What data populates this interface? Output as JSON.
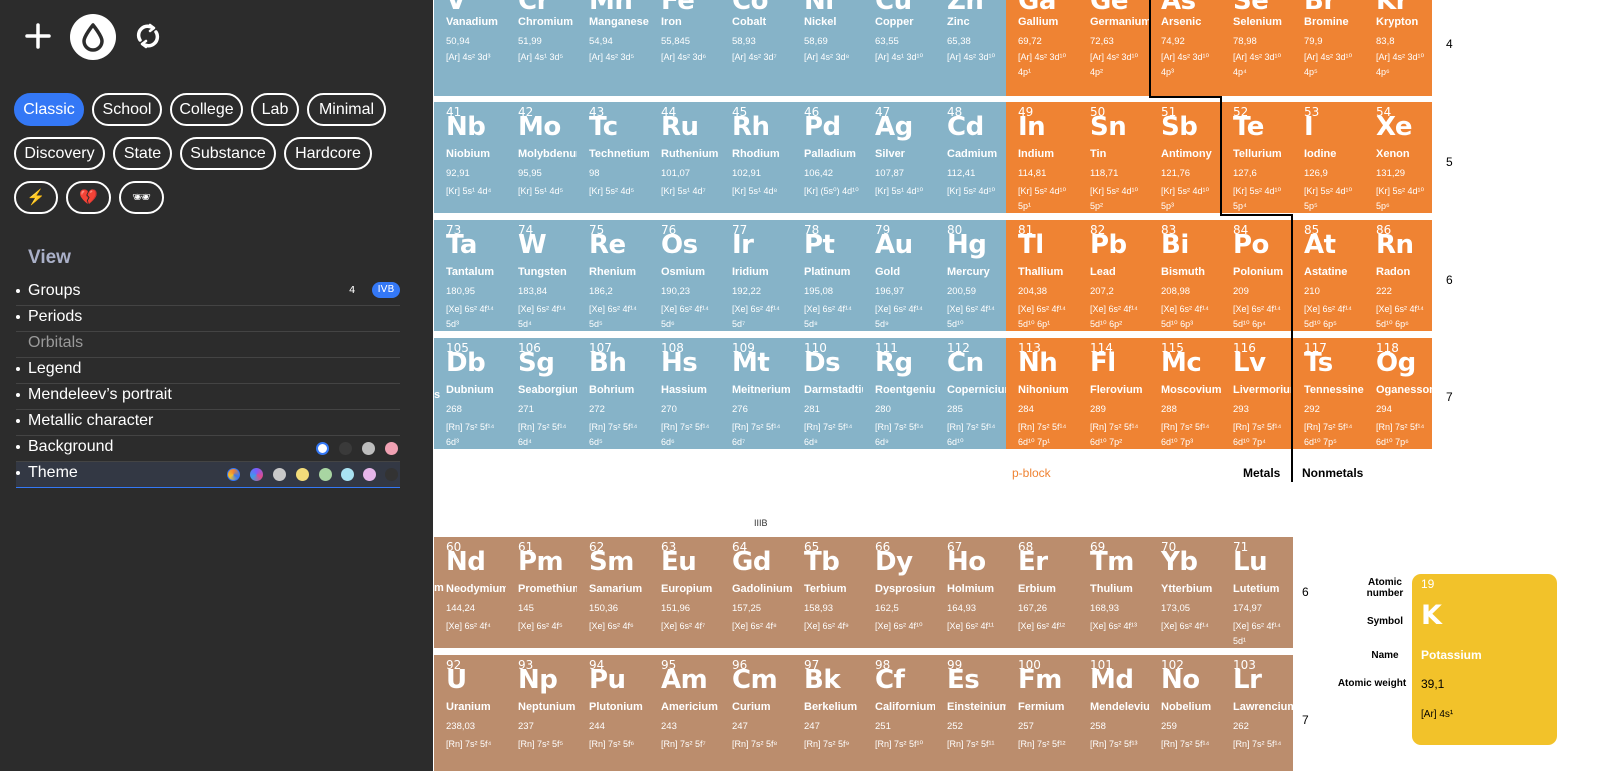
{
  "toolbar": {
    "plus": "+",
    "theme": "drop",
    "reload": "reload"
  },
  "modes": {
    "row1": [
      "Classic",
      "School",
      "College",
      "Lab",
      "Minimal"
    ],
    "row2": [
      "Discovery",
      "State",
      "Substance",
      "Hardcore"
    ],
    "row3": [
      "⚡",
      "💔",
      "🕶"
    ]
  },
  "view": {
    "title": "View",
    "items": [
      "Groups",
      "Periods",
      "Orbitals",
      "Legend",
      "Mendeleev’s portrait",
      "Metallic character",
      "Background",
      "Theme"
    ],
    "groups_value": "4",
    "groups_badge": "IVB",
    "background_colors": [
      "#2c2c2c",
      "#3a3a3a",
      "#bdbdbd",
      "#f0a1b3"
    ],
    "theme_colors": [
      "#c9c9c9",
      "#f3dc7a",
      "#a8d5a2",
      "#a9e2f2",
      "#e6b6ea",
      "#333333"
    ]
  },
  "elements": [
    {
      "n": "",
      "s": "V",
      "name": "Vanadium",
      "w": "50,94",
      "c": "[Ar] 4s² 3d³"
    },
    {
      "n": "",
      "s": "Cr",
      "name": "Chromium",
      "w": "51,99",
      "c": "[Ar] 4s¹ 3d⁵"
    },
    {
      "n": "",
      "s": "Mn",
      "name": "Manganese",
      "w": "54,94",
      "c": "[Ar] 4s² 3d⁵"
    },
    {
      "n": "",
      "s": "Fe",
      "name": "Iron",
      "w": "55,845",
      "c": "[Ar] 4s² 3d⁶"
    },
    {
      "n": "",
      "s": "Co",
      "name": "Cobalt",
      "w": "58,93",
      "c": "[Ar] 4s² 3d⁷"
    },
    {
      "n": "",
      "s": "Ni",
      "name": "Nickel",
      "w": "58,69",
      "c": "[Ar] 4s² 3d⁸"
    },
    {
      "n": "",
      "s": "Cu",
      "name": "Copper",
      "w": "63,55",
      "c": "[Ar] 4s¹ 3d¹⁰"
    },
    {
      "n": "",
      "s": "Zn",
      "name": "Zinc",
      "w": "65,38",
      "c": "[Ar] 4s² 3d¹⁰"
    },
    {
      "n": "",
      "s": "Ga",
      "name": "Gallium",
      "w": "69,72",
      "c": "[Ar] 4s² 3d¹⁰ 4p¹"
    },
    {
      "n": "",
      "s": "Ge",
      "name": "Germanium",
      "w": "72,63",
      "c": "[Ar] 4s² 3d¹⁰ 4p²"
    },
    {
      "n": "",
      "s": "As",
      "name": "Arsenic",
      "w": "74,92",
      "c": "[Ar] 4s² 3d¹⁰ 4p³"
    },
    {
      "n": "",
      "s": "Se",
      "name": "Selenium",
      "w": "78,98",
      "c": "[Ar] 4s² 3d¹⁰ 4p⁴"
    },
    {
      "n": "",
      "s": "Br",
      "name": "Bromine",
      "w": "79,9",
      "c": "[Ar] 4s² 3d¹⁰ 4p⁵"
    },
    {
      "n": "",
      "s": "Kr",
      "name": "Krypton",
      "w": "83,8",
      "c": "[Ar] 4s² 3d¹⁰ 4p⁶"
    },
    {
      "n": "41",
      "s": "Nb",
      "name": "Niobium",
      "w": "92,91",
      "c": "[Kr] 5s¹ 4d⁴"
    },
    {
      "n": "42",
      "s": "Mo",
      "name": "Molybdenum",
      "w": "95,95",
      "c": "[Kr] 5s¹ 4d⁵"
    },
    {
      "n": "43",
      "s": "Tc",
      "name": "Technetium",
      "w": "98",
      "c": "[Kr] 5s² 4d⁵"
    },
    {
      "n": "44",
      "s": "Ru",
      "name": "Ruthenium",
      "w": "101,07",
      "c": "[Kr] 5s¹ 4d⁷"
    },
    {
      "n": "45",
      "s": "Rh",
      "name": "Rhodium",
      "w": "102,91",
      "c": "[Kr] 5s¹ 4d⁸"
    },
    {
      "n": "46",
      "s": "Pd",
      "name": "Palladium",
      "w": "106,42",
      "c": "[Kr] (5s⁰) 4d¹⁰"
    },
    {
      "n": "47",
      "s": "Ag",
      "name": "Silver",
      "w": "107,87",
      "c": "[Kr] 5s¹ 4d¹⁰"
    },
    {
      "n": "48",
      "s": "Cd",
      "name": "Cadmium",
      "w": "112,41",
      "c": "[Kr] 5s² 4d¹⁰"
    },
    {
      "n": "49",
      "s": "In",
      "name": "Indium",
      "w": "114,81",
      "c": "[Kr] 5s² 4d¹⁰ 5p¹"
    },
    {
      "n": "50",
      "s": "Sn",
      "name": "Tin",
      "w": "118,71",
      "c": "[Kr] 5s² 4d¹⁰ 5p²"
    },
    {
      "n": "51",
      "s": "Sb",
      "name": "Antimony",
      "w": "121,76",
      "c": "[Kr] 5s² 4d¹⁰ 5p³"
    },
    {
      "n": "52",
      "s": "Te",
      "name": "Tellurium",
      "w": "127,6",
      "c": "[Kr] 5s² 4d¹⁰ 5p⁴"
    },
    {
      "n": "53",
      "s": "I",
      "name": "Iodine",
      "w": "126,9",
      "c": "[Kr] 5s² 4d¹⁰ 5p⁵"
    },
    {
      "n": "54",
      "s": "Xe",
      "name": "Xenon",
      "w": "131,29",
      "c": "[Kr] 5s² 4d¹⁰ 5p⁶"
    },
    {
      "n": "73",
      "s": "Ta",
      "name": "Tantalum",
      "w": "180,95",
      "c": "[Xe] 6s² 4f¹⁴ 5d³"
    },
    {
      "n": "74",
      "s": "W",
      "name": "Tungsten",
      "w": "183,84",
      "c": "[Xe] 6s² 4f¹⁴ 5d⁴"
    },
    {
      "n": "75",
      "s": "Re",
      "name": "Rhenium",
      "w": "186,2",
      "c": "[Xe] 6s² 4f¹⁴ 5d⁵"
    },
    {
      "n": "76",
      "s": "Os",
      "name": "Osmium",
      "w": "190,23",
      "c": "[Xe] 6s² 4f¹⁴ 5d⁶"
    },
    {
      "n": "77",
      "s": "Ir",
      "name": "Iridium",
      "w": "192,22",
      "c": "[Xe] 6s² 4f¹⁴ 5d⁷"
    },
    {
      "n": "78",
      "s": "Pt",
      "name": "Platinum",
      "w": "195,08",
      "c": "[Xe] 6s² 4f¹⁴ 5d⁸"
    },
    {
      "n": "79",
      "s": "Au",
      "name": "Gold",
      "w": "196,97",
      "c": "[Xe] 6s² 4f¹⁴ 5d⁹"
    },
    {
      "n": "80",
      "s": "Hg",
      "name": "Mercury",
      "w": "200,59",
      "c": "[Xe] 6s² 4f¹⁴ 5d¹⁰"
    },
    {
      "n": "81",
      "s": "Tl",
      "name": "Thallium",
      "w": "204,38",
      "c": "[Xe] 6s² 4f¹⁴ 5d¹⁰ 6p¹"
    },
    {
      "n": "82",
      "s": "Pb",
      "name": "Lead",
      "w": "207,2",
      "c": "[Xe] 6s² 4f¹⁴ 5d¹⁰ 6p²"
    },
    {
      "n": "83",
      "s": "Bi",
      "name": "Bismuth",
      "w": "208,98",
      "c": "[Xe] 6s² 4f¹⁴ 5d¹⁰ 6p³"
    },
    {
      "n": "84",
      "s": "Po",
      "name": "Polonium",
      "w": "209",
      "c": "[Xe] 6s² 4f¹⁴ 5d¹⁰ 6p⁴"
    },
    {
      "n": "85",
      "s": "At",
      "name": "Astatine",
      "w": "210",
      "c": "[Xe] 6s² 4f¹⁴ 5d¹⁰ 6p⁵"
    },
    {
      "n": "86",
      "s": "Rn",
      "name": "Radon",
      "w": "222",
      "c": "[Xe] 6s² 4f¹⁴ 5d¹⁰ 6p⁶"
    },
    {
      "n": "105",
      "s": "Db",
      "name": "Dubnium",
      "w": "268",
      "c": "[Rn] 7s² 5f¹⁴ 6d³"
    },
    {
      "n": "106",
      "s": "Sg",
      "name": "Seaborgium",
      "w": "271",
      "c": "[Rn] 7s² 5f¹⁴ 6d⁴"
    },
    {
      "n": "107",
      "s": "Bh",
      "name": "Bohrium",
      "w": "272",
      "c": "[Rn] 7s² 5f¹⁴ 6d⁵"
    },
    {
      "n": "108",
      "s": "Hs",
      "name": "Hassium",
      "w": "270",
      "c": "[Rn] 7s² 5f¹⁴ 6d⁶"
    },
    {
      "n": "109",
      "s": "Mt",
      "name": "Meitnerium",
      "w": "276",
      "c": "[Rn] 7s² 5f¹⁴ 6d⁷"
    },
    {
      "n": "110",
      "s": "Ds",
      "name": "Darmstadtium",
      "w": "281",
      "c": "[Rn] 7s² 5f¹⁴ 6d⁸"
    },
    {
      "n": "111",
      "s": "Rg",
      "name": "Roentgenium",
      "w": "280",
      "c": "[Rn] 7s² 5f¹⁴ 6d⁹"
    },
    {
      "n": "112",
      "s": "Cn",
      "name": "Copernicium",
      "w": "285",
      "c": "[Rn] 7s² 5f¹⁴ 6d¹⁰"
    },
    {
      "n": "113",
      "s": "Nh",
      "name": "Nihonium",
      "w": "284",
      "c": "[Rn] 7s² 5f¹⁴ 6d¹⁰ 7p¹"
    },
    {
      "n": "114",
      "s": "Fl",
      "name": "Flerovium",
      "w": "289",
      "c": "[Rn] 7s² 5f¹⁴ 6d¹⁰ 7p²"
    },
    {
      "n": "115",
      "s": "Mc",
      "name": "Moscovium",
      "w": "288",
      "c": "[Rn] 7s² 5f¹⁴ 6d¹⁰ 7p³"
    },
    {
      "n": "116",
      "s": "Lv",
      "name": "Livermorium",
      "w": "293",
      "c": "[Rn] 7s² 5f¹⁴ 6d¹⁰ 7p⁴"
    },
    {
      "n": "117",
      "s": "Ts",
      "name": "Tennessine",
      "w": "292",
      "c": "[Rn] 7s² 5f¹⁴ 6d¹⁰ 7p⁵"
    },
    {
      "n": "118",
      "s": "Og",
      "name": "Oganesson",
      "w": "294",
      "c": "[Rn] 7s² 5f¹⁴ 6d¹⁰ 7p⁶"
    }
  ],
  "lanthanides": [
    {
      "n": "60",
      "s": "Nd",
      "name": "Neodymium",
      "w": "144,24",
      "c": "[Xe] 6s² 4f⁴"
    },
    {
      "n": "61",
      "s": "Pm",
      "name": "Promethium",
      "w": "145",
      "c": "[Xe] 6s² 4f⁵"
    },
    {
      "n": "62",
      "s": "Sm",
      "name": "Samarium",
      "w": "150,36",
      "c": "[Xe] 6s² 4f⁶"
    },
    {
      "n": "63",
      "s": "Eu",
      "name": "Europium",
      "w": "151,96",
      "c": "[Xe] 6s² 4f⁷"
    },
    {
      "n": "64",
      "s": "Gd",
      "name": "Gadolinium",
      "w": "157,25",
      "c": "[Xe] 6s² 4f⁸"
    },
    {
      "n": "65",
      "s": "Tb",
      "name": "Terbium",
      "w": "158,93",
      "c": "[Xe] 6s² 4f⁹"
    },
    {
      "n": "66",
      "s": "Dy",
      "name": "Dysprosium",
      "w": "162,5",
      "c": "[Xe] 6s² 4f¹⁰"
    },
    {
      "n": "67",
      "s": "Ho",
      "name": "Holmium",
      "w": "164,93",
      "c": "[Xe] 6s² 4f¹¹"
    },
    {
      "n": "68",
      "s": "Er",
      "name": "Erbium",
      "w": "167,26",
      "c": "[Xe] 6s² 4f¹²"
    },
    {
      "n": "69",
      "s": "Tm",
      "name": "Thulium",
      "w": "168,93",
      "c": "[Xe] 6s² 4f¹³"
    },
    {
      "n": "70",
      "s": "Yb",
      "name": "Ytterbium",
      "w": "173,05",
      "c": "[Xe] 6s² 4f¹⁴"
    },
    {
      "n": "71",
      "s": "Lu",
      "name": "Lutetium",
      "w": "174,97",
      "c": "[Xe] 6s² 4f¹⁴ 5d¹"
    }
  ],
  "actinides": [
    {
      "n": "92",
      "s": "U",
      "name": "Uranium",
      "w": "238,03",
      "c": "[Rn] 7s² 5f⁴"
    },
    {
      "n": "93",
      "s": "Np",
      "name": "Neptunium",
      "w": "237",
      "c": "[Rn] 7s² 5f⁵"
    },
    {
      "n": "94",
      "s": "Pu",
      "name": "Plutonium",
      "w": "244",
      "c": "[Rn] 7s² 5f⁶"
    },
    {
      "n": "95",
      "s": "Am",
      "name": "Americium",
      "w": "243",
      "c": "[Rn] 7s² 5f⁷"
    },
    {
      "n": "96",
      "s": "Cm",
      "name": "Curium",
      "w": "247",
      "c": "[Rn] 7s² 5f⁸"
    },
    {
      "n": "97",
      "s": "Bk",
      "name": "Berkelium",
      "w": "247",
      "c": "[Rn] 7s² 5f⁹"
    },
    {
      "n": "98",
      "s": "Cf",
      "name": "Californium",
      "w": "251",
      "c": "[Rn] 7s² 5f¹⁰"
    },
    {
      "n": "99",
      "s": "Es",
      "name": "Einsteinium",
      "w": "252",
      "c": "[Rn] 7s² 5f¹¹"
    },
    {
      "n": "100",
      "s": "Fm",
      "name": "Fermium",
      "w": "257",
      "c": "[Rn] 7s² 5f¹²"
    },
    {
      "n": "101",
      "s": "Md",
      "name": "Mendelevium",
      "w": "258",
      "c": "[Rn] 7s² 5f¹³"
    },
    {
      "n": "102",
      "s": "No",
      "name": "Nobelium",
      "w": "259",
      "c": "[Rn] 7s² 5f¹⁴"
    },
    {
      "n": "103",
      "s": "Lr",
      "name": "Lawrencium",
      "w": "262",
      "c": "[Rn] 7s² 5f¹⁴"
    }
  ],
  "period_labels": [
    "4",
    "5",
    "6",
    "7"
  ],
  "f_period_labels": [
    "6",
    "7"
  ],
  "labels": {
    "pblock": "p-block",
    "metals": "Metals",
    "nonmetals": "Nonmetals",
    "iiib": "IIIB",
    "lanth_partial": "m",
    "db_partial": "s"
  },
  "legend": {
    "atomic_number_label": "Atomic number",
    "symbol_label": "Symbol",
    "name_label": "Name",
    "atomic_weight_label": "Atomic weight",
    "number": "19",
    "symbol": "K",
    "name": "Potassium",
    "weight": "39,1",
    "config": "[Ar] 4s¹"
  },
  "colors": {
    "d_block": "#86b3c8",
    "p_block": "#ef8333",
    "f_block": "#bb8d6d",
    "legend": "#f2c22a",
    "accent": "#3478f6",
    "pblock_label": "#ef8333"
  }
}
